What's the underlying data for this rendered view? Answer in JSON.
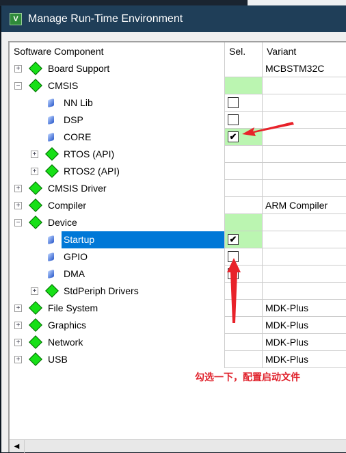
{
  "window": {
    "title": "Manage Run-Time Environment",
    "logo": "uVision-logo"
  },
  "headers": {
    "component": "Software Component",
    "sel": "Sel.",
    "variant": "Variant"
  },
  "rows": [
    {
      "name": "Board Support",
      "level": 0,
      "expander": "plus",
      "icon": "diamond",
      "variant": "MCBSTM32C"
    },
    {
      "name": "CMSIS",
      "level": 0,
      "expander": "minus",
      "icon": "diamond",
      "sel_green": true
    },
    {
      "name": "NN Lib",
      "level": 1,
      "icon": "gem",
      "checkbox": false
    },
    {
      "name": "DSP",
      "level": 1,
      "icon": "gem",
      "checkbox": false
    },
    {
      "name": "CORE",
      "level": 1,
      "icon": "gem",
      "checkbox": true,
      "sel_green": true
    },
    {
      "name": "RTOS (API)",
      "level": 1,
      "expander": "plus",
      "icon": "diamond"
    },
    {
      "name": "RTOS2 (API)",
      "level": 1,
      "expander": "plus",
      "icon": "diamond"
    },
    {
      "name": "CMSIS Driver",
      "level": 0,
      "expander": "plus",
      "icon": "diamond"
    },
    {
      "name": "Compiler",
      "level": 0,
      "expander": "plus",
      "icon": "diamond",
      "variant": "ARM Compiler"
    },
    {
      "name": "Device",
      "level": 0,
      "expander": "minus",
      "icon": "diamond",
      "sel_green": true
    },
    {
      "name": "Startup",
      "level": 1,
      "icon": "gem",
      "checkbox": true,
      "sel_green": true,
      "selected": true
    },
    {
      "name": "GPIO",
      "level": 1,
      "icon": "gem",
      "checkbox": false
    },
    {
      "name": "DMA",
      "level": 1,
      "icon": "gem",
      "checkbox": false
    },
    {
      "name": "StdPeriph Drivers",
      "level": 1,
      "expander": "plus",
      "icon": "diamond"
    },
    {
      "name": "File System",
      "level": 0,
      "expander": "plus",
      "icon": "diamond",
      "variant": "MDK-Plus"
    },
    {
      "name": "Graphics",
      "level": 0,
      "expander": "plus",
      "icon": "diamond",
      "variant": "MDK-Plus"
    },
    {
      "name": "Network",
      "level": 0,
      "expander": "plus",
      "icon": "diamond",
      "variant": "MDK-Plus"
    },
    {
      "name": "USB",
      "level": 0,
      "expander": "plus",
      "icon": "diamond",
      "variant": "MDK-Plus"
    }
  ],
  "annotation": {
    "text": "勾选一下，配置启动文件",
    "color": "#e0202a"
  },
  "colors": {
    "titlebar": "#1f3e58",
    "selection": "#0078d7",
    "sel_green": "#bbf5b1"
  }
}
